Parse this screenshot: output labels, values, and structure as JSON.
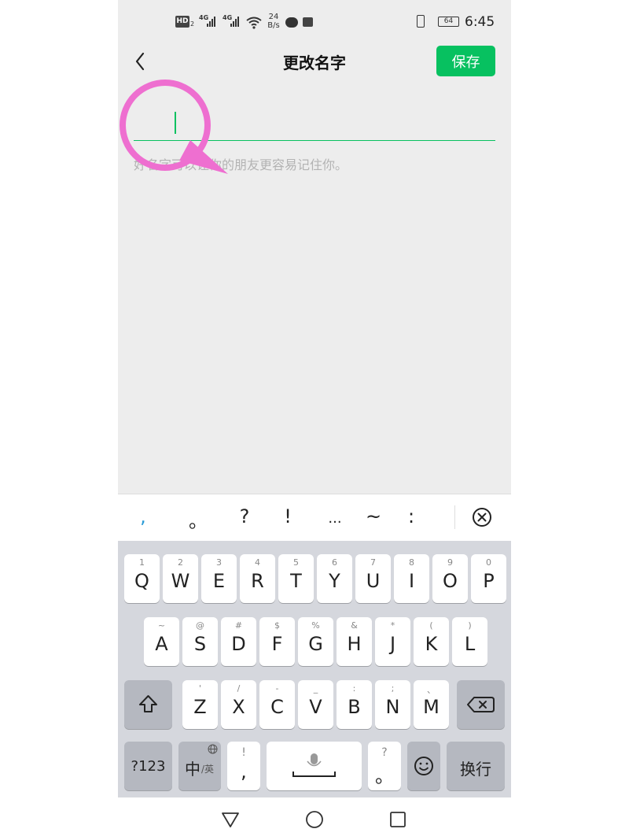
{
  "status_bar": {
    "hd_label": "HD",
    "hd_sub": "2",
    "sim1_tag": "4G",
    "sim2_tag": "4G",
    "speed_value": "24",
    "speed_unit": "B/s",
    "battery": "64",
    "time": "6:45"
  },
  "header": {
    "title": "更改名字",
    "save_label": "保存"
  },
  "name_input": {
    "value": ""
  },
  "hint": "好名字可以让你的朋友更容易记住你。",
  "candidates": [
    ",",
    "。",
    "?",
    "!",
    "...",
    "~",
    ":"
  ],
  "keyboard": {
    "row1": [
      {
        "main": "Q",
        "sub": "1"
      },
      {
        "main": "W",
        "sub": "2"
      },
      {
        "main": "E",
        "sub": "3"
      },
      {
        "main": "R",
        "sub": "4"
      },
      {
        "main": "T",
        "sub": "5"
      },
      {
        "main": "Y",
        "sub": "6"
      },
      {
        "main": "U",
        "sub": "7"
      },
      {
        "main": "I",
        "sub": "8"
      },
      {
        "main": "O",
        "sub": "9"
      },
      {
        "main": "P",
        "sub": "0"
      }
    ],
    "row2": [
      {
        "main": "A",
        "sub": "~"
      },
      {
        "main": "S",
        "sub": "@"
      },
      {
        "main": "D",
        "sub": "#"
      },
      {
        "main": "F",
        "sub": "$"
      },
      {
        "main": "G",
        "sub": "%"
      },
      {
        "main": "H",
        "sub": "&"
      },
      {
        "main": "J",
        "sub": "*"
      },
      {
        "main": "K",
        "sub": "("
      },
      {
        "main": "L",
        "sub": ")"
      }
    ],
    "row3": [
      {
        "main": "Z",
        "sub": "'"
      },
      {
        "main": "X",
        "sub": "/"
      },
      {
        "main": "C",
        "sub": "-"
      },
      {
        "main": "V",
        "sub": "_"
      },
      {
        "main": "B",
        "sub": ":"
      },
      {
        "main": "N",
        "sub": ";"
      },
      {
        "main": "M",
        "sub": "、"
      }
    ],
    "num_label": "?123",
    "lang_main": "中",
    "lang_sub": "/英",
    "comma_sub": "!",
    "comma_main": ",",
    "period_sub": "?",
    "period_main": "。",
    "enter_label": "换行"
  },
  "colors": {
    "accent": "#07c160",
    "annotation": "#ee6fd0"
  },
  "icons": {
    "back": "chevron-left-icon",
    "close": "circle-x-icon",
    "shift": "shift-arrow-icon",
    "backspace": "backspace-icon",
    "mic": "microphone-icon",
    "emoji": "smiley-icon",
    "globe": "globe-icon",
    "nav_back": "triangle-back-icon",
    "nav_home": "circle-home-icon",
    "nav_recent": "square-recent-icon"
  }
}
